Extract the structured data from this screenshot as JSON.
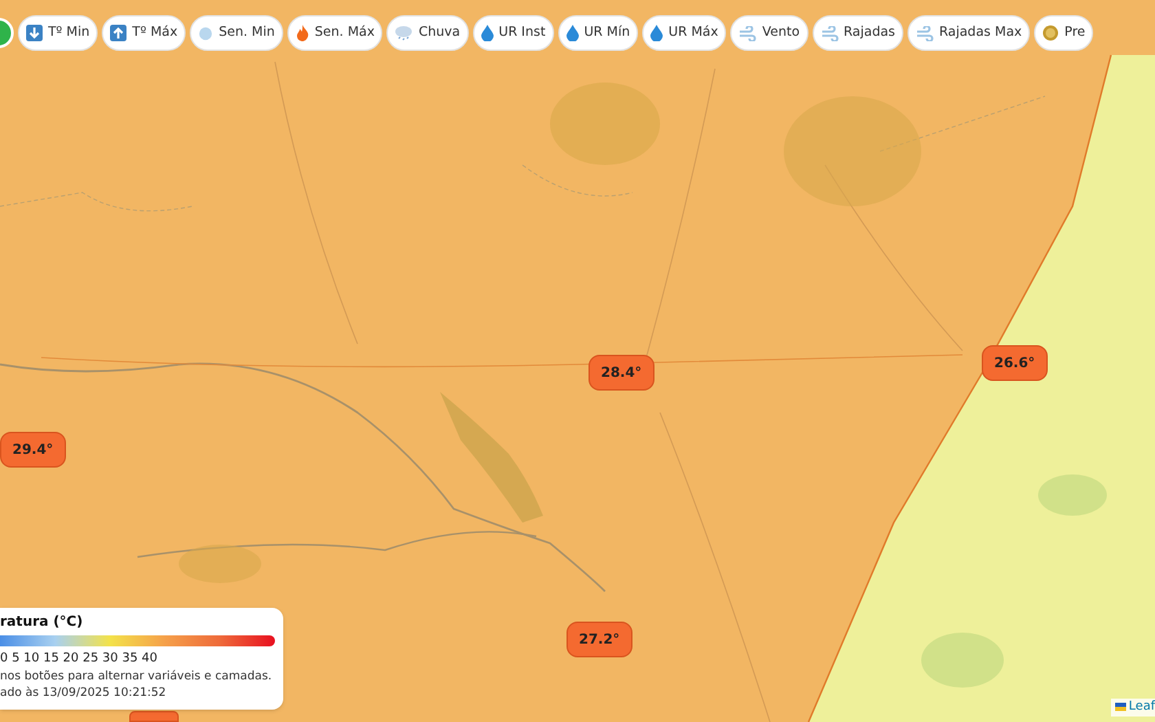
{
  "toolbar": {
    "buttons": [
      {
        "label": "Tº Min",
        "kind": "arrow-down"
      },
      {
        "label": "Tº Máx",
        "kind": "arrow-up"
      },
      {
        "label": "Sen. Min",
        "kind": "snow"
      },
      {
        "label": "Sen. Máx",
        "kind": "fire"
      },
      {
        "label": "Chuva",
        "kind": "rain"
      },
      {
        "label": "UR Inst",
        "kind": "drop"
      },
      {
        "label": "UR Mín",
        "kind": "drop"
      },
      {
        "label": "UR Máx",
        "kind": "drop"
      },
      {
        "label": "Vento",
        "kind": "wind"
      },
      {
        "label": "Rajadas",
        "kind": "wind"
      },
      {
        "label": "Rajadas Max",
        "kind": "wind"
      },
      {
        "label": "Pre",
        "kind": "coin"
      }
    ]
  },
  "markers": [
    {
      "label": "28.4°"
    },
    {
      "label": "26.6°"
    },
    {
      "label": "29.4°"
    },
    {
      "label": "27.2°"
    }
  ],
  "legend": {
    "title": "ratura (°C)",
    "scale": "0 5 10 15 20 25 30 35 40",
    "hint": "nos botões para alternar variáveis e camadas.",
    "updated": "ado às 13/09/2025 10:21:52"
  },
  "attribution": "Leaf"
}
